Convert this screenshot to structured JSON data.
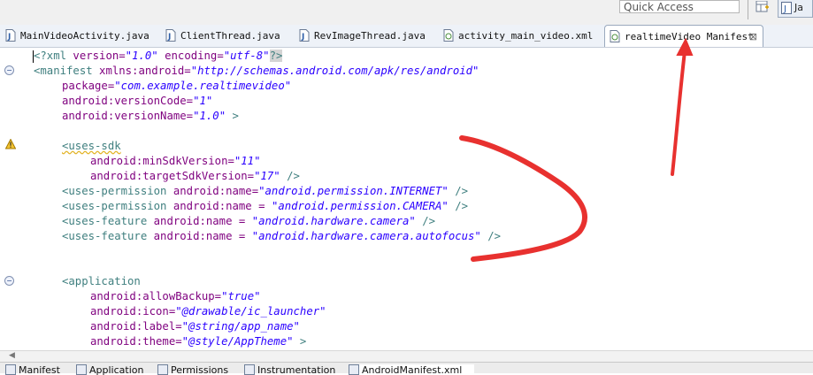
{
  "toolbar": {
    "quick_access_placeholder": "Quick Access",
    "java_perspective_label": "Ja"
  },
  "tabs": [
    {
      "label": "MainVideoActivity.java",
      "icon": "java-file-icon"
    },
    {
      "label": "ClientThread.java",
      "icon": "java-file-icon"
    },
    {
      "label": "RevImageThread.java",
      "icon": "java-file-icon"
    },
    {
      "label": "activity_main_video.xml",
      "icon": "xml-file-icon"
    },
    {
      "label": "realtimeVideo Manifest",
      "icon": "manifest-icon",
      "active": true,
      "close": "⊠"
    }
  ],
  "code": {
    "l1_open": "<?xml",
    "l1_a1": " version=",
    "l1_v1": "\"1.0\"",
    "l1_a2": " encoding=",
    "l1_v2": "\"utf-8\"",
    "l1_close": "?>",
    "l2_tag": "<manifest",
    "l2_attr": " xmlns:android=",
    "l2_val": "\"http://schemas.android.com/apk/res/android\"",
    "l3_attr": "package=",
    "l3_val": "\"com.example.realtimevideo\"",
    "l4_attr": "android:versionCode=",
    "l4_val": "\"1\"",
    "l5_attr": "android:versionName=",
    "l5_val": "\"1.0\"",
    "l5_close": " >",
    "l7_tag": "<uses-sdk",
    "l8_attr": "android:minSdkVersion=",
    "l8_val": "\"11\"",
    "l9_attr": "android:targetSdkVersion=",
    "l9_val": "\"17\"",
    "l9_close": " />",
    "l10_tag": "<uses-permission",
    "l10_attr": " android:name=",
    "l10_val": "\"android.permission.INTERNET\"",
    "l10_close": " />",
    "l11_tag": "<uses-permission",
    "l11_attr": " android:name = ",
    "l11_val": "\"android.permission.CAMERA\"",
    "l11_close": " />",
    "l12_tag": "<uses-feature",
    "l12_attr": " android:name = ",
    "l12_val": "\"android.hardware.camera\"",
    "l12_close": " />",
    "l13_tag": "<uses-feature",
    "l13_attr": " android:name = ",
    "l13_val": "\"android.hardware.camera.autofocus\"",
    "l13_close": " />",
    "l16_tag": "<application",
    "l17_attr": "android:allowBackup=",
    "l17_val": "\"true\"",
    "l18_attr": "android:icon=",
    "l18_val": "\"@drawable/ic_launcher\"",
    "l19_attr": "android:label=",
    "l19_val": "\"@string/app_name\"",
    "l20_attr": "android:theme=",
    "l20_val": "\"@style/AppTheme\"",
    "l20_close": " >"
  },
  "bottom_tabs": [
    "Manifest",
    "Application",
    "Permissions",
    "Instrumentation",
    "AndroidManifest.xml"
  ],
  "colors": {
    "tag": "#3f7f7f",
    "attribute": "#7f007f",
    "value": "#2a00ff",
    "annotation": "#e8312f"
  }
}
